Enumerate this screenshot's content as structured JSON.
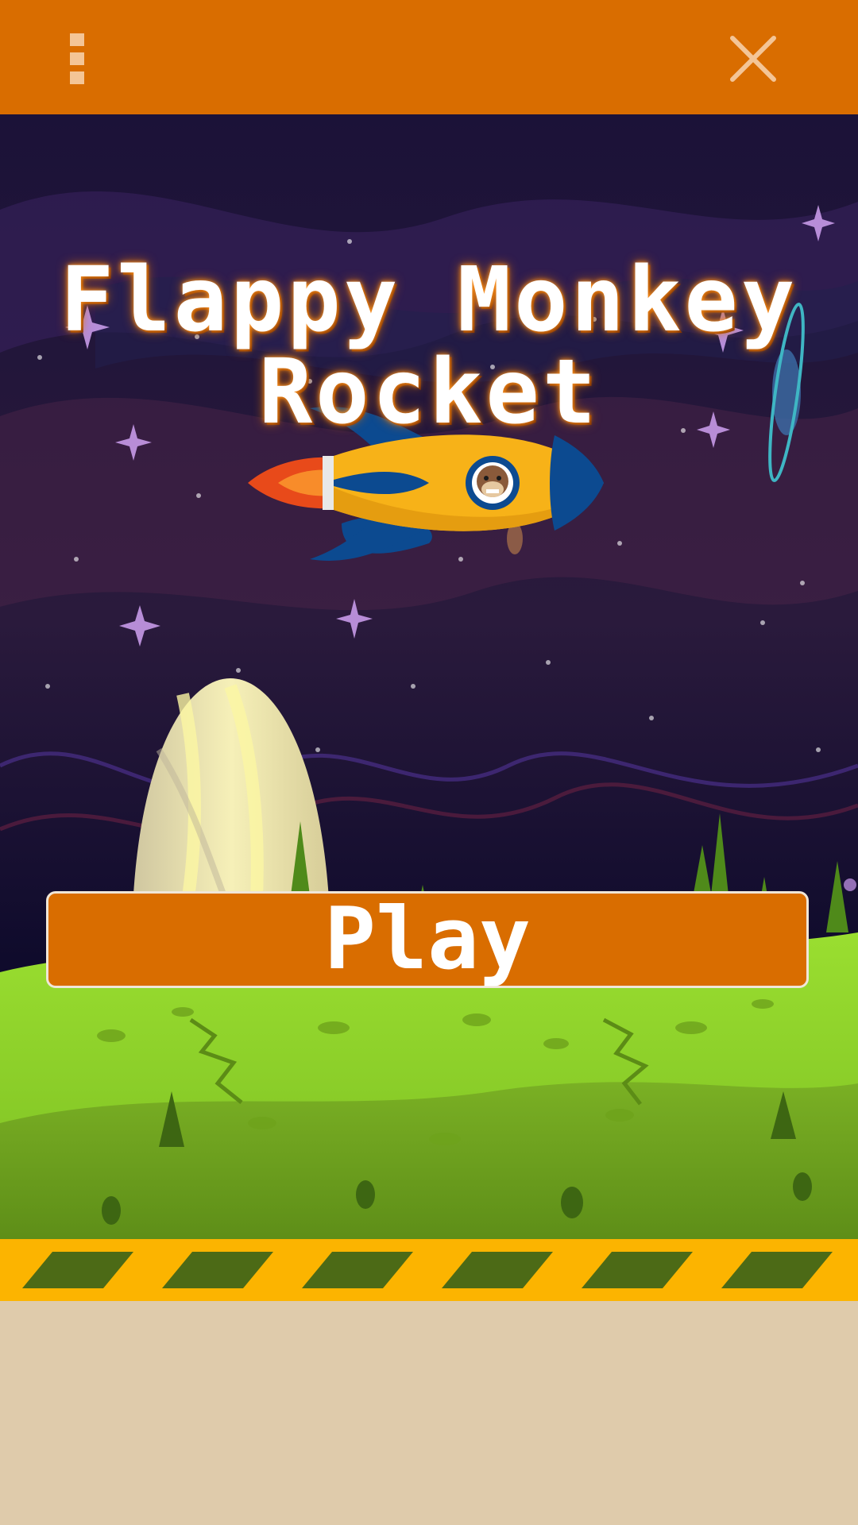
{
  "header": {
    "menu_icon": "overflow-menu-icon",
    "close_icon": "close-icon",
    "background_color": "#d96d00"
  },
  "game": {
    "title_line1": "Flappy Monkey",
    "title_line2": "Rocket",
    "play_label": "Play"
  },
  "colors": {
    "accent": "#d96d00",
    "sky": "#0e0a2a",
    "ground": "#8fd22a",
    "hazard_yellow": "#fcb400",
    "hazard_stripe": "#4c6a16",
    "footer": "#dfcbab"
  }
}
